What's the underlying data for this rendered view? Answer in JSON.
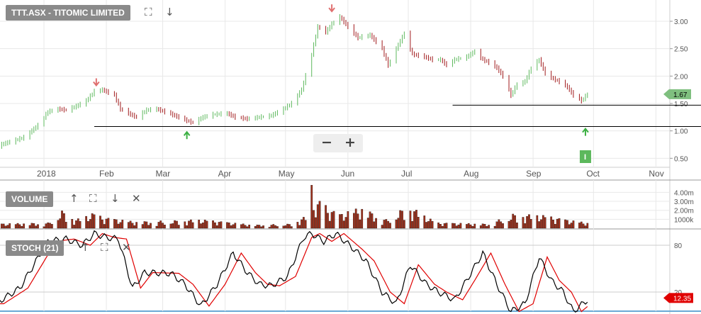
{
  "main_panel": {
    "title": "TTT.ASX - TITOMIC LIMITED",
    "expand_icon": "⛶",
    "collapse_icon": "↓",
    "zoom_out": "−",
    "zoom_in": "+"
  },
  "volume_panel": {
    "title": "VOLUME",
    "up_icon": "↑",
    "expand_icon": "⛶",
    "down_icon": "↓",
    "close_icon": "✕"
  },
  "stoch_panel": {
    "title": "STOCH (21)",
    "up_icon": "↑",
    "expand_icon": "⛶",
    "close_icon": "✕"
  },
  "colors": {
    "up": "#5cb85c",
    "down": "#a0191b",
    "volume": "#a0301b",
    "k_line": "#000000",
    "d_line": "#e00000",
    "last_price_bg": "#7fbf7f",
    "stoch_label_bg": "#e00000",
    "grid": "#e8e8e8"
  },
  "chart_data": {
    "type": "candlestick",
    "x_tick_labels": [
      "2018",
      "Feb",
      "Mar",
      "Apr",
      "May",
      "Jun",
      "Jul",
      "Aug",
      "Sep",
      "Oct",
      "Nov"
    ],
    "price_axis": {
      "ticks": [
        "3.00",
        "2.50",
        "2.00",
        "1.50",
        "1.00",
        "0.50"
      ],
      "range": [
        0.35,
        3.35
      ]
    },
    "last_price_label": "1.67",
    "support_lines": [
      {
        "level": 1.08,
        "from": "Jan 26",
        "to": "Nov 30"
      },
      {
        "level": 1.47,
        "from": "Jul 23",
        "to": "Nov 30"
      }
    ],
    "annotations": [
      {
        "date": "Jan 27",
        "price": 1.83,
        "direction": "down"
      },
      {
        "date": "Mar 13",
        "price": 0.98,
        "direction": "up"
      },
      {
        "date": "May 24",
        "price": 3.18,
        "direction": "down"
      },
      {
        "date": "Sep 27",
        "price": 1.04,
        "direction": "up"
      }
    ],
    "event_marker": {
      "date": "Sep 27",
      "label": "I"
    },
    "volume_axis": {
      "ticks": [
        "4.00m",
        "3.00m",
        "2.00m",
        "1000k"
      ]
    },
    "stoch_axis": {
      "ticks": [
        "80",
        "20"
      ]
    },
    "stoch_last_label": "12.35",
    "price_path": [
      [
        "Dec 08",
        0.72
      ],
      [
        "Dec 15",
        0.8
      ],
      [
        "Dec 22",
        0.88
      ],
      [
        "Dec 29",
        1.1
      ],
      [
        "Jan 03",
        1.35
      ],
      [
        "Jan 08",
        1.4
      ],
      [
        "Jan 12",
        1.38
      ],
      [
        "Jan 17",
        1.45
      ],
      [
        "Jan 22",
        1.55
      ],
      [
        "Jan 26",
        1.72
      ],
      [
        "Jan 30",
        1.75
      ],
      [
        "Feb 05",
        1.65
      ],
      [
        "Feb 08",
        1.4
      ],
      [
        "Feb 13",
        1.3
      ],
      [
        "Feb 16",
        1.25
      ],
      [
        "Feb 21",
        1.38
      ],
      [
        "Feb 26",
        1.4
      ],
      [
        "Mar 02",
        1.35
      ],
      [
        "Mar 07",
        1.28
      ],
      [
        "Mar 12",
        1.2
      ],
      [
        "Mar 16",
        1.15
      ],
      [
        "Mar 21",
        1.25
      ],
      [
        "Mar 26",
        1.3
      ],
      [
        "Apr 02",
        1.32
      ],
      [
        "Apr 06",
        1.25
      ],
      [
        "Apr 12",
        1.22
      ],
      [
        "Apr 18",
        1.25
      ],
      [
        "Apr 24",
        1.28
      ],
      [
        "Apr 30",
        1.4
      ],
      [
        "May 04",
        1.5
      ],
      [
        "May 09",
        1.75
      ],
      [
        "May 14",
        2.4
      ],
      [
        "May 17",
        2.9
      ],
      [
        "May 21",
        2.8
      ],
      [
        "May 24",
        2.95
      ],
      [
        "May 28",
        3.08
      ],
      [
        "Jun 01",
        2.9
      ],
      [
        "Jun 06",
        2.7
      ],
      [
        "Jun 12",
        2.75
      ],
      [
        "Jun 18",
        2.5
      ],
      [
        "Jun 21",
        2.2
      ],
      [
        "Jun 25",
        2.5
      ],
      [
        "Jun 29",
        2.78
      ],
      [
        "Jul 03",
        2.4
      ],
      [
        "Jul 09",
        2.35
      ],
      [
        "Jul 13",
        2.3
      ],
      [
        "Jul 17",
        2.3
      ],
      [
        "Jul 20",
        2.2
      ],
      [
        "Jul 24",
        2.3
      ],
      [
        "Jul 30",
        2.35
      ],
      [
        "Aug 03",
        2.45
      ],
      [
        "Aug 07",
        2.3
      ],
      [
        "Aug 10",
        2.25
      ],
      [
        "Aug 14",
        2.15
      ],
      [
        "Aug 17",
        2.0
      ],
      [
        "Aug 21",
        1.65
      ],
      [
        "Aug 24",
        1.85
      ],
      [
        "Aug 28",
        1.9
      ],
      [
        "Aug 31",
        2.15
      ],
      [
        "Sep 04",
        2.3
      ],
      [
        "Sep 07",
        2.05
      ],
      [
        "Sep 11",
        1.95
      ],
      [
        "Sep 14",
        1.9
      ],
      [
        "Sep 18",
        1.8
      ],
      [
        "Sep 21",
        1.65
      ],
      [
        "Sep 25",
        1.55
      ],
      [
        "Sep 28",
        1.67
      ]
    ],
    "volume_path": [
      [
        "Dec 08",
        0.4
      ],
      [
        "Jan 03",
        0.5
      ],
      [
        "Jan 10",
        1.6
      ],
      [
        "Jan 17",
        0.8
      ],
      [
        "Jan 26",
        1.4
      ],
      [
        "Jan 30",
        1.0
      ],
      [
        "Feb 15",
        0.6
      ],
      [
        "Mar 05",
        0.7
      ],
      [
        "Mar 20",
        0.8
      ],
      [
        "Apr 15",
        0.3
      ],
      [
        "May 04",
        0.4
      ],
      [
        "May 11",
        1.1
      ],
      [
        "May 14",
        4.8
      ],
      [
        "May 16",
        1.5
      ],
      [
        "May 18",
        2.8
      ],
      [
        "May 22",
        1.8
      ],
      [
        "May 28",
        1.3
      ],
      [
        "Jun 08",
        1.9
      ],
      [
        "Jun 20",
        0.8
      ],
      [
        "Jul 01",
        2.1
      ],
      [
        "Jul 15",
        0.5
      ],
      [
        "Aug 10",
        0.4
      ],
      [
        "Aug 22",
        1.3
      ],
      [
        "Sep 05",
        1.2
      ],
      [
        "Sep 20",
        0.7
      ],
      [
        "Sep 28",
        0.5
      ]
    ],
    "stoch_k": [
      [
        "Dec 08",
        5
      ],
      [
        "Dec 20",
        25
      ],
      [
        "Jan 03",
        85
      ],
      [
        "Jan 12",
        88
      ],
      [
        "Jan 20",
        80
      ],
      [
        "Jan 26",
        95
      ],
      [
        "Feb 01",
        90
      ],
      [
        "Feb 07",
        88
      ],
      [
        "Feb 14",
        25
      ],
      [
        "Feb 20",
        45
      ],
      [
        "Mar 05",
        44
      ],
      [
        "Mar 12",
        30
      ],
      [
        "Mar 20",
        2
      ],
      [
        "Mar 28",
        30
      ],
      [
        "Apr 05",
        70
      ],
      [
        "Apr 12",
        45
      ],
      [
        "Apr 18",
        30
      ],
      [
        "Apr 24",
        28
      ],
      [
        "May 02",
        40
      ],
      [
        "May 10",
        90
      ],
      [
        "May 14",
        95
      ],
      [
        "May 20",
        85
      ],
      [
        "May 26",
        95
      ],
      [
        "Jun 04",
        75
      ],
      [
        "Jun 10",
        60
      ],
      [
        "Jun 18",
        20
      ],
      [
        "Jun 25",
        5
      ],
      [
        "Jul 02",
        55
      ],
      [
        "Jul 10",
        30
      ],
      [
        "Jul 16",
        20
      ],
      [
        "Jul 24",
        10
      ],
      [
        "Jul 30",
        35
      ],
      [
        "Aug 07",
        70
      ],
      [
        "Aug 14",
        30
      ],
      [
        "Aug 21",
        -5
      ],
      [
        "Aug 28",
        5
      ],
      [
        "Sep 04",
        65
      ],
      [
        "Sep 10",
        35
      ],
      [
        "Sep 16",
        20
      ],
      [
        "Sep 21",
        -5
      ],
      [
        "Sep 28",
        10
      ]
    ]
  }
}
